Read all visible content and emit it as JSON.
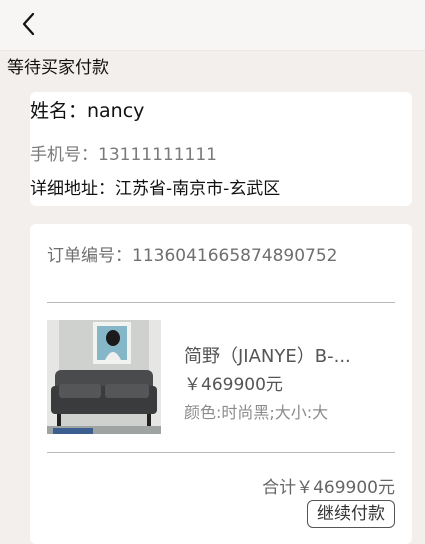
{
  "header": {
    "back_icon": "chevron-left-icon"
  },
  "order_status": "等待买家付款",
  "address": {
    "name": "姓名：nancy",
    "phone": "手机号：13111111111",
    "detail": "详细地址：江苏省-南京市-玄武区"
  },
  "order": {
    "number": "订单编号：1136041665874890752",
    "product": {
      "name": "简野（JIANYE）B-...",
      "price": "￥469900元",
      "spec": "颜色:时尚黑;大小:大"
    },
    "total": "合计￥469900元",
    "pay_label": "继续付款"
  }
}
